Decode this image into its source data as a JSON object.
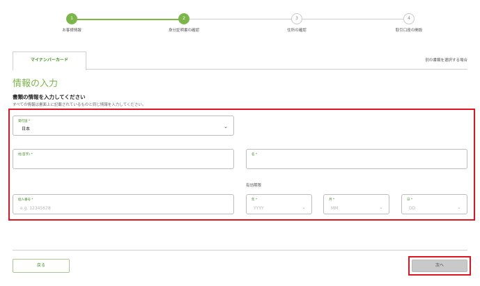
{
  "stepper": {
    "steps": [
      {
        "number": "1",
        "label": "お客様情報",
        "status": "done"
      },
      {
        "number": "2",
        "label": "身分証明書の確認",
        "status": "done"
      },
      {
        "number": "3",
        "label": "住所の確認",
        "status": "todo"
      },
      {
        "number": "4",
        "label": "取引口座の開設",
        "status": "todo"
      }
    ]
  },
  "tabs": {
    "active_label": "マイナンバーカード",
    "other_link": "別の書類を選択する場合"
  },
  "section_title": "情報の入力",
  "form": {
    "heading": "書類の情報を入力してください",
    "description": "すべての情報は書面上に記載されているものと同じ情報を入力してください。",
    "issuing_country": {
      "label": "発行国 *",
      "value": "日本"
    },
    "surname": {
      "label": "姓(苗字) *",
      "value": ""
    },
    "given_name": {
      "label": "名 *",
      "value": ""
    },
    "expiry_section_label": "有効期限",
    "personal_number": {
      "label": "個人番号 *",
      "placeholder": "e.g. 12345678"
    },
    "expiry_year": {
      "label": "年 *",
      "placeholder": "YYYY"
    },
    "expiry_month": {
      "label": "月 *",
      "placeholder": "MM"
    },
    "expiry_day": {
      "label": "日 *",
      "placeholder": "DD"
    }
  },
  "footer": {
    "back_label": "戻る",
    "next_label": "次へ"
  },
  "colors": {
    "accent_green": "#7ab648",
    "highlight_red": "#e0141e",
    "disabled_button": "#c9c9c9"
  }
}
